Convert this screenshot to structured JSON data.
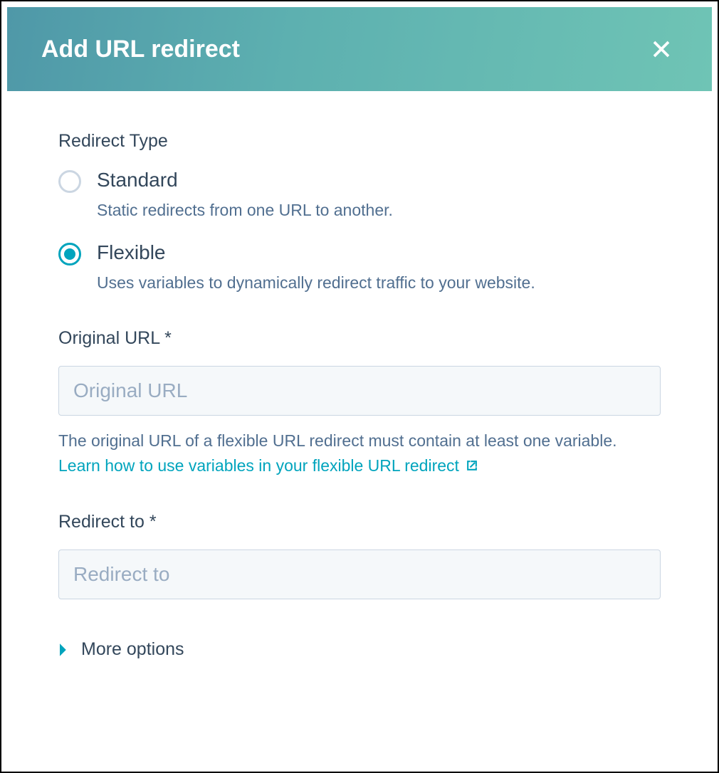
{
  "header": {
    "title": "Add URL redirect"
  },
  "form": {
    "redirectType": {
      "label": "Redirect Type",
      "options": [
        {
          "label": "Standard",
          "description": "Static redirects from one URL to another.",
          "selected": false
        },
        {
          "label": "Flexible",
          "description": "Uses variables to dynamically redirect traffic to your website.",
          "selected": true
        }
      ]
    },
    "originalUrl": {
      "label": "Original URL *",
      "placeholder": "Original URL",
      "value": "",
      "helper": "The original URL of a flexible URL redirect must contain at least one variable.",
      "link": "Learn how to use variables in your flexible URL redirect"
    },
    "redirectTo": {
      "label": "Redirect to *",
      "placeholder": "Redirect to",
      "value": ""
    },
    "moreOptions": {
      "label": "More options"
    }
  }
}
